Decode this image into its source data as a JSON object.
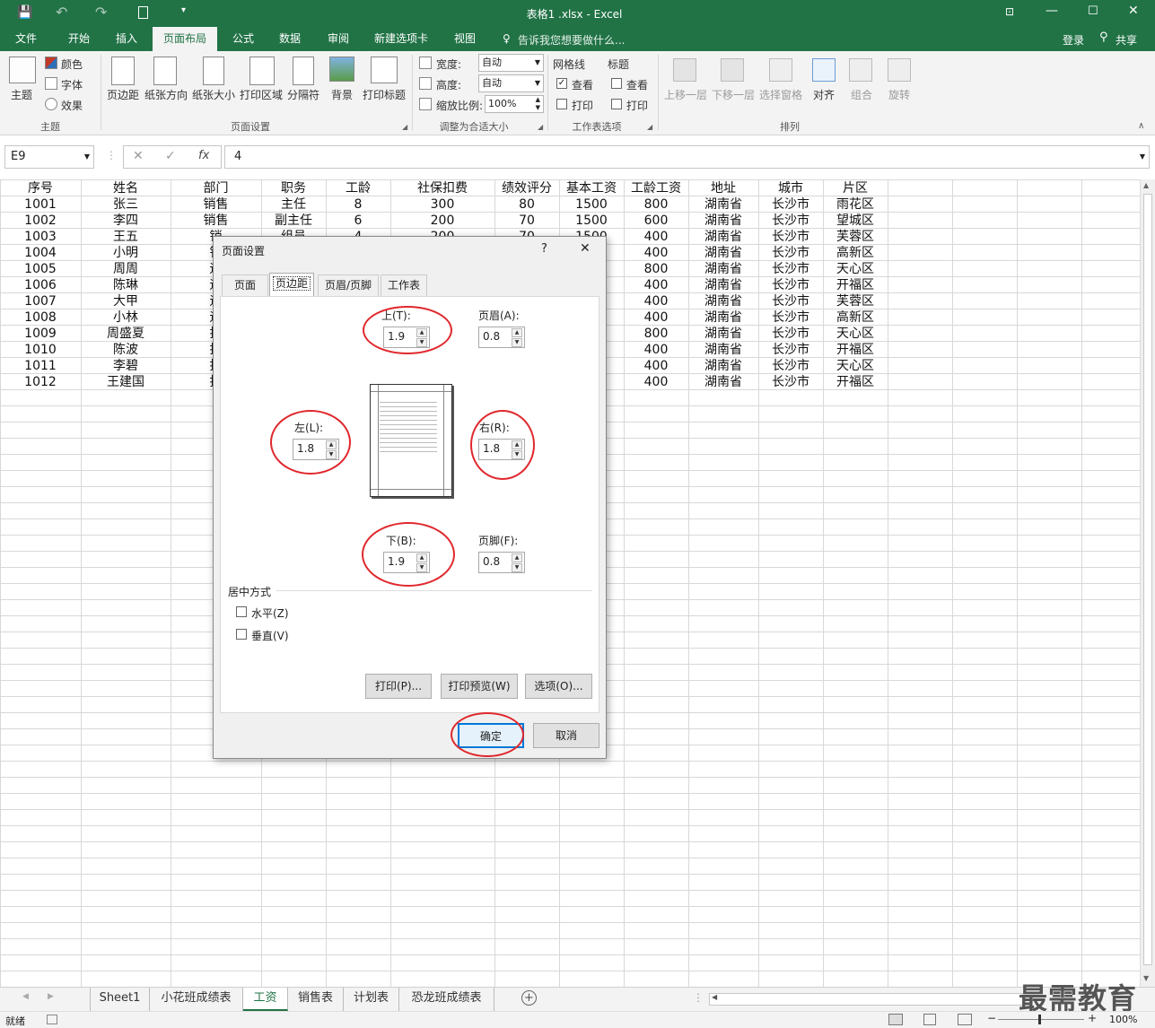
{
  "window": {
    "title": "表格1 .xlsx - Excel"
  },
  "qat": {
    "save": "save-icon",
    "undo": "undo-icon",
    "redo": "redo-icon",
    "new": "new-doc-icon",
    "customize": "customize-icon"
  },
  "ribbon_tabs": [
    "文件",
    "开始",
    "插入",
    "页面布局",
    "公式",
    "数据",
    "审阅",
    "新建选项卡",
    "视图"
  ],
  "tell_me": "告诉我您想要做什么...",
  "account": {
    "login": "登录",
    "share": "共享"
  },
  "ribbon": {
    "theme": {
      "themes": "主题",
      "colors": "颜色",
      "fonts": "字体",
      "effects": "效果",
      "group": "主题"
    },
    "page_setup": {
      "margins": "页边距",
      "orientation": "纸张方向",
      "size": "纸张大小",
      "print_area": "打印区域",
      "breaks": "分隔符",
      "background": "背景",
      "print_titles": "打印标题",
      "group": "页面设置"
    },
    "scale": {
      "width_label": "宽度:",
      "width_value": "自动",
      "height_label": "高度:",
      "height_value": "自动",
      "scale_label": "缩放比例:",
      "scale_value": "100%",
      "group": "调整为合适大小"
    },
    "sheet_options": {
      "gridlines": "网格线",
      "headings": "标题",
      "view": "查看",
      "print": "打印",
      "group": "工作表选项"
    },
    "arrange": {
      "forward": "上移一层",
      "backward": "下移一层",
      "selection_pane": "选择窗格",
      "align": "对齐",
      "group_btn": "组合",
      "rotate": "旋转",
      "group": "排列"
    }
  },
  "formula_bar": {
    "name_box": "E9",
    "formula": "4",
    "fx": "fx"
  },
  "sheet": {
    "headers": [
      "序号",
      "姓名",
      "部门",
      "职务",
      "工龄",
      "社保扣费",
      "绩效评分",
      "基本工资",
      "工龄工资",
      "地址",
      "城市",
      "片区"
    ],
    "rows": [
      [
        "1001",
        "张三",
        "销售",
        "主任",
        "8",
        "300",
        "80",
        "1500",
        "800",
        "湖南省",
        "长沙市",
        "雨花区"
      ],
      [
        "1002",
        "李四",
        "销售",
        "副主任",
        "6",
        "200",
        "70",
        "1500",
        "600",
        "湖南省",
        "长沙市",
        "望城区"
      ],
      [
        "1003",
        "王五",
        "销",
        "组员",
        "4",
        "200",
        "70",
        "1500",
        "400",
        "湖南省",
        "长沙市",
        "芙蓉区"
      ],
      [
        "1004",
        "小明",
        "销",
        "",
        "",
        "",
        "",
        "",
        "400",
        "湖南省",
        "长沙市",
        "高新区"
      ],
      [
        "1005",
        "周周",
        "运",
        "",
        "",
        "",
        "",
        "",
        "800",
        "湖南省",
        "长沙市",
        "天心区"
      ],
      [
        "1006",
        "陈琳",
        "运",
        "",
        "",
        "",
        "",
        "",
        "400",
        "湖南省",
        "长沙市",
        "开福区"
      ],
      [
        "1007",
        "大甲",
        "运",
        "",
        "",
        "",
        "",
        "",
        "400",
        "湖南省",
        "长沙市",
        "芙蓉区"
      ],
      [
        "1008",
        "小林",
        "运",
        "",
        "",
        "",
        "",
        "",
        "400",
        "湖南省",
        "长沙市",
        "高新区"
      ],
      [
        "1009",
        "周盛夏",
        "技",
        "",
        "",
        "",
        "",
        "",
        "800",
        "湖南省",
        "长沙市",
        "天心区"
      ],
      [
        "1010",
        "陈波",
        "技",
        "",
        "",
        "",
        "",
        "",
        "400",
        "湖南省",
        "长沙市",
        "开福区"
      ],
      [
        "1011",
        "李碧",
        "技",
        "",
        "",
        "",
        "",
        "",
        "400",
        "湖南省",
        "长沙市",
        "天心区"
      ],
      [
        "1012",
        "王建国",
        "技",
        "",
        "",
        "",
        "",
        "",
        "400",
        "湖南省",
        "长沙市",
        "开福区"
      ]
    ]
  },
  "dialog": {
    "title": "页面设置",
    "help": "?",
    "close": "✕",
    "tabs": [
      "页面",
      "页边距",
      "页眉/页脚",
      "工作表"
    ],
    "top_label": "上(T):",
    "top_value": "1.9",
    "header_label": "页眉(A):",
    "header_value": "0.8",
    "left_label": "左(L):",
    "left_value": "1.8",
    "right_label": "右(R):",
    "right_value": "1.8",
    "bottom_label": "下(B):",
    "bottom_value": "1.9",
    "footer_label": "页脚(F):",
    "footer_value": "0.8",
    "center_label": "居中方式",
    "horizontal": "水平(Z)",
    "vertical": "垂直(V)",
    "print_btn": "打印(P)...",
    "preview_btn": "打印预览(W)",
    "options_btn": "选项(O)...",
    "ok": "确定",
    "cancel": "取消"
  },
  "sheet_tabs": [
    "Sheet1",
    "小花班成绩表",
    "工资",
    "销售表",
    "计划表",
    "恐龙班成绩表"
  ],
  "watermark": "最需教育",
  "status": {
    "ready": "就绪",
    "zoom": "100%"
  }
}
